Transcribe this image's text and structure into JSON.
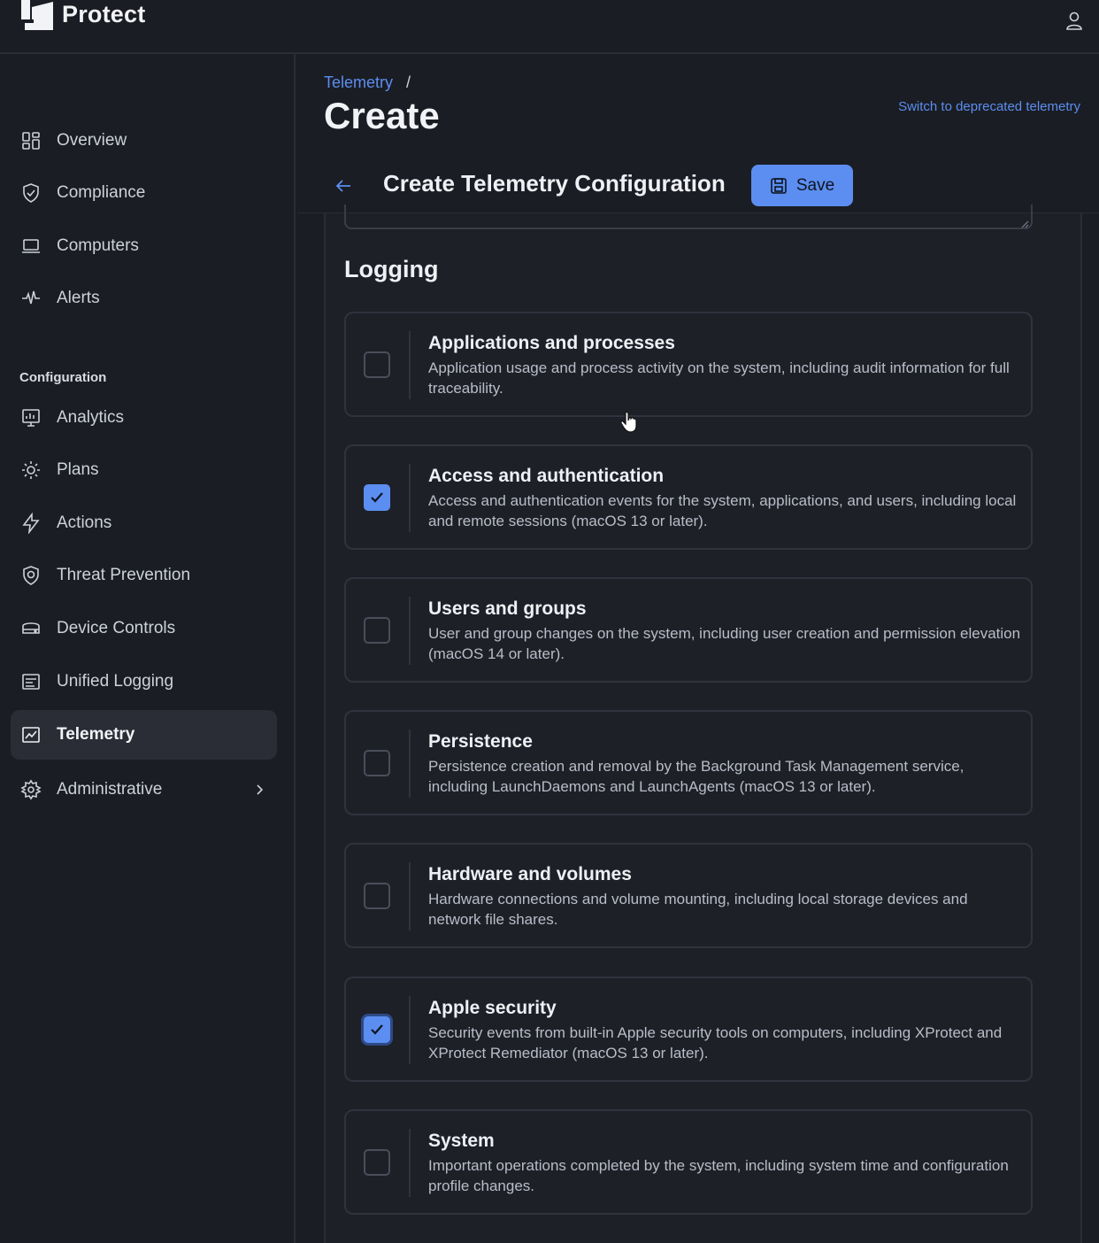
{
  "app": {
    "name": "Protect"
  },
  "sidebar": {
    "items_top": [
      {
        "label": "Overview",
        "icon": "grid-icon"
      },
      {
        "label": "Compliance",
        "icon": "shield-check-icon"
      },
      {
        "label": "Computers",
        "icon": "laptop-icon"
      },
      {
        "label": "Alerts",
        "icon": "pulse-icon"
      }
    ],
    "section_label": "Configuration",
    "items_config": [
      {
        "label": "Analytics",
        "icon": "monitor-chart-icon"
      },
      {
        "label": "Plans",
        "icon": "gear-sun-icon"
      },
      {
        "label": "Actions",
        "icon": "bolt-icon"
      },
      {
        "label": "Threat Prevention",
        "icon": "shield-target-icon"
      },
      {
        "label": "Device Controls",
        "icon": "drive-icon"
      },
      {
        "label": "Unified Logging",
        "icon": "log-icon"
      },
      {
        "label": "Telemetry",
        "icon": "chart-image-icon",
        "active": true
      },
      {
        "label": "Administrative",
        "icon": "settings-icon"
      }
    ]
  },
  "header": {
    "breadcrumb_link": "Telemetry",
    "breadcrumb_sep": "/",
    "title": "Create",
    "deprecated_link": "Switch to deprecated telemetry",
    "form_title": "Create Telemetry Configuration",
    "save_label": "Save"
  },
  "logging": {
    "title": "Logging",
    "cards": [
      {
        "title": "Applications and processes",
        "desc": "Application usage and process activity on the system, including audit information for full traceability.",
        "checked": false
      },
      {
        "title": "Access and authentication",
        "desc": "Access and authentication events for the system, applications, and users, including local and remote sessions (macOS 13 or later).",
        "checked": true
      },
      {
        "title": "Users and groups",
        "desc": "User and group changes on the system, including user creation and permission elevation (macOS 14 or later).",
        "checked": false
      },
      {
        "title": "Persistence",
        "desc": "Persistence creation and removal by the Background Task Management service, including LaunchDaemons and LaunchAgents (macOS 13 or later).",
        "checked": false
      },
      {
        "title": "Hardware and volumes",
        "desc": "Hardware connections and volume mounting, including local storage devices and network file shares.",
        "checked": false
      },
      {
        "title": "Apple security",
        "desc": "Security events from built-in Apple security tools on computers, including XProtect and XProtect Remediator (macOS 13 or later).",
        "checked": true
      },
      {
        "title": "System",
        "desc": "Important operations completed by the system, including system time and configuration profile changes.",
        "checked": false
      }
    ]
  },
  "colors": {
    "accent": "#5b8ef0",
    "background": "#1b1d24",
    "active_nav": "#2a2d36"
  }
}
